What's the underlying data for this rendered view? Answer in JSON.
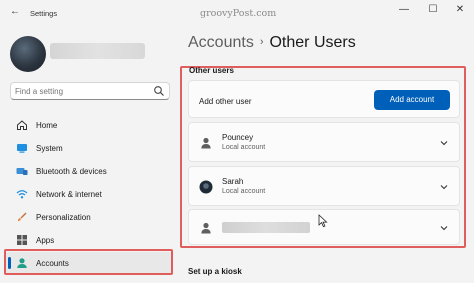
{
  "window": {
    "app_title": "Settings",
    "watermark": "groovyPost.com",
    "min_glyph": "—",
    "max_glyph": "☐",
    "close_glyph": "✕",
    "back_glyph": "←"
  },
  "sidebar": {
    "search": {
      "placeholder": "Find a setting"
    },
    "items": [
      {
        "label": "Home",
        "icon": "home-icon",
        "active": false
      },
      {
        "label": "System",
        "icon": "system-icon",
        "active": false
      },
      {
        "label": "Bluetooth & devices",
        "icon": "bluetooth-icon",
        "active": false
      },
      {
        "label": "Network & internet",
        "icon": "wifi-icon",
        "active": false
      },
      {
        "label": "Personalization",
        "icon": "brush-icon",
        "active": false
      },
      {
        "label": "Apps",
        "icon": "apps-icon",
        "active": false
      },
      {
        "label": "Accounts",
        "icon": "accounts-icon",
        "active": true
      }
    ]
  },
  "main": {
    "breadcrumb": {
      "parent": "Accounts",
      "separator": "›",
      "current": "Other Users"
    },
    "other_users": {
      "section_title": "Other users",
      "add_label": "Add other user",
      "add_button": "Add account",
      "users": [
        {
          "name": "Pouncey",
          "type": "Local account"
        },
        {
          "name": "Sarah",
          "type": "Local account"
        }
      ]
    },
    "kiosk_title": "Set up a kiosk"
  },
  "colors": {
    "accent": "#005fb8",
    "highlight": "#e05d5d",
    "background": "#f3f3f3"
  }
}
